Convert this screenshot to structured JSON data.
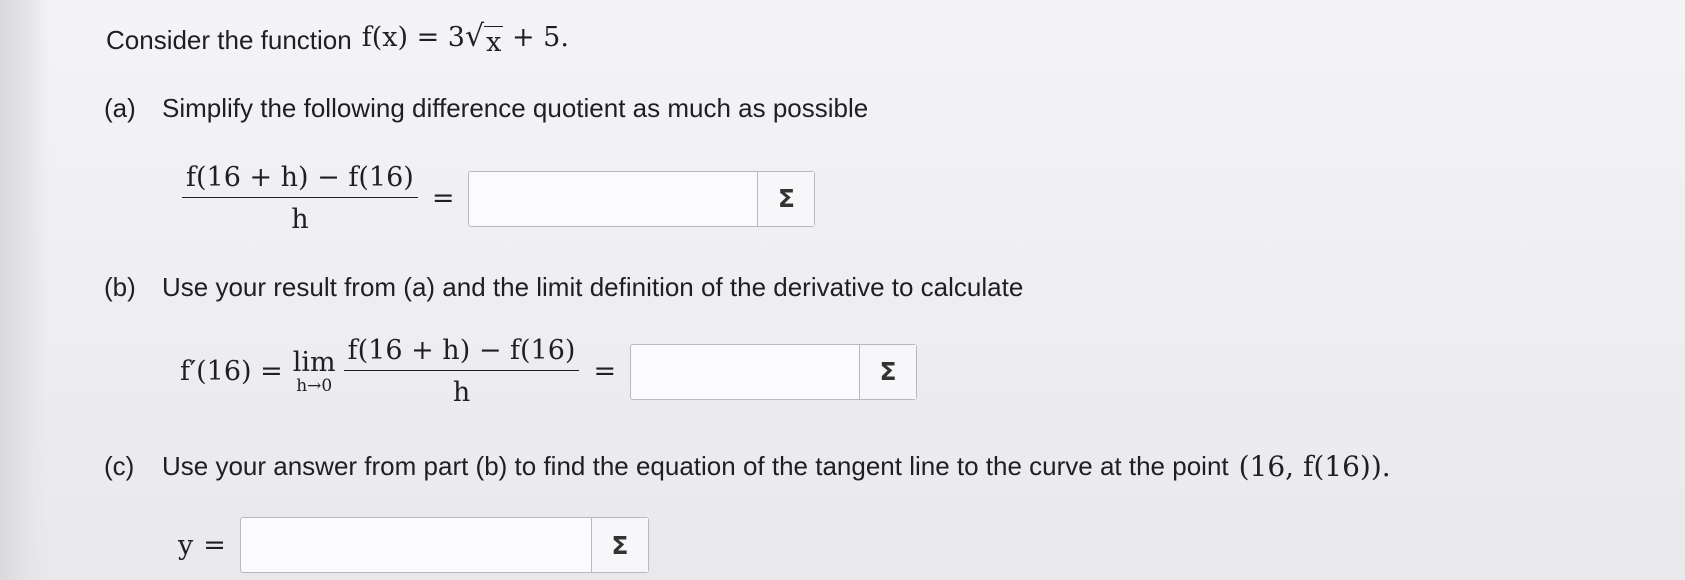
{
  "intro": {
    "text": "Consider the function",
    "fx": "f(x) = 3",
    "sqrt_arg": "x",
    "tail": "+ 5."
  },
  "part_a": {
    "label": "(a)",
    "instruction": "Simplify the following difference quotient as much as possible",
    "numerator": "f(16 + h) − f(16)",
    "denominator": "h",
    "equals": "=",
    "answer_value": "",
    "sigma": "Σ"
  },
  "part_b": {
    "label": "(b)",
    "instruction": "Use your result from (a) and the limit definition of the derivative to calculate",
    "lhs": "f′(16) =",
    "lim": "lim",
    "lim_sub": "h→0",
    "numerator": "f(16 + h) − f(16)",
    "denominator": "h",
    "equals": "=",
    "answer_value": "",
    "sigma": "Σ"
  },
  "part_c": {
    "label": "(c)",
    "instruction": "Use your answer from part (b) to find the equation of the tangent line to the curve at the point",
    "point": "(16, f(16)).",
    "y_label": "y",
    "equals": "=",
    "answer_value": "",
    "sigma": "Σ"
  }
}
